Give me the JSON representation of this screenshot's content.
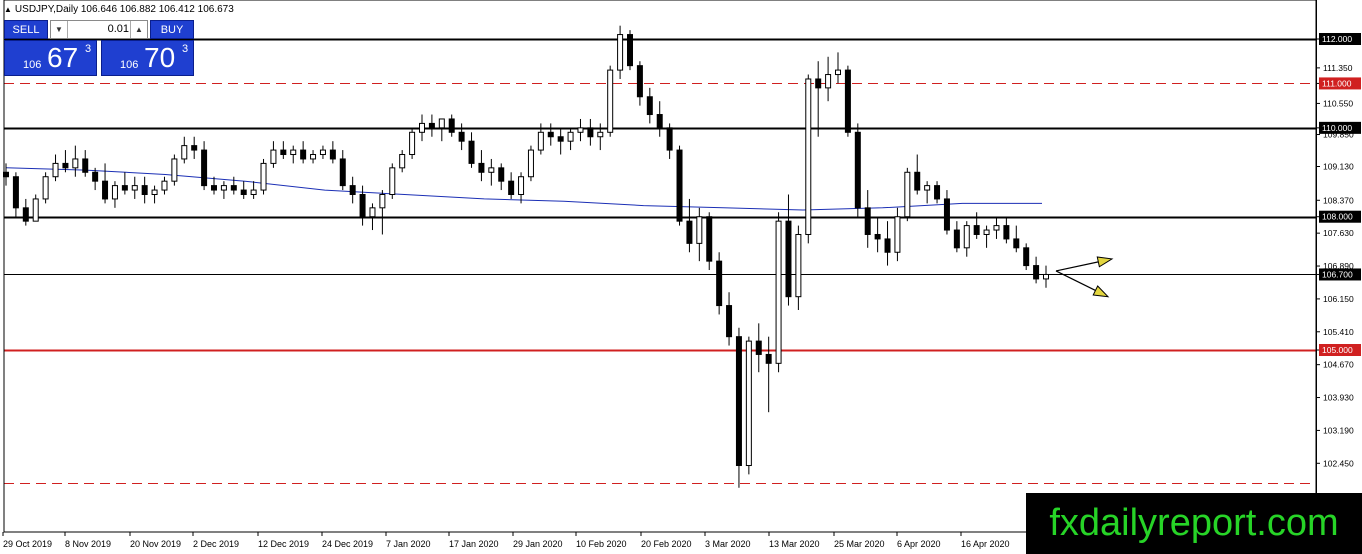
{
  "symbol_line": "USDJPY,Daily  106.646 106.882 106.412 106.673",
  "trade_panel": {
    "sell_label": "SELL",
    "buy_label": "BUY",
    "lot_value": "0.01",
    "sell_price_big": "106",
    "sell_price_large": "67",
    "sell_price_sup": "3",
    "buy_price_big": "106",
    "buy_price_large": "70",
    "buy_price_sup": "3"
  },
  "watermark": "fxdailyreport.com",
  "chart_data": {
    "type": "candlestick",
    "symbol": "USDJPY",
    "timeframe": "Daily",
    "ohlc_current": {
      "open": 106.646,
      "high": 106.882,
      "low": 106.412,
      "close": 106.673
    },
    "ylim": [
      101.8,
      113.0
    ],
    "price_ticks": [
      "112.000",
      "111.350",
      "111.000",
      "110.550",
      "110.000",
      "109.850",
      "109.130",
      "108.370",
      "108.000",
      "107.630",
      "106.890",
      "106.700",
      "106.150",
      "105.410",
      "105.000",
      "104.670",
      "103.930",
      "103.190",
      "102.450"
    ],
    "time_ticks": [
      "29 Oct 2019",
      "8 Nov 2019",
      "20 Nov 2019",
      "2 Dec 2019",
      "12 Dec 2019",
      "24 Dec 2019",
      "7 Jan 2020",
      "17 Jan 2020",
      "29 Jan 2020",
      "10 Feb 2020",
      "20 Feb 2020",
      "3 Mar 2020",
      "13 Mar 2020",
      "25 Mar 2020",
      "6 Apr 2020",
      "16 Apr 2020"
    ],
    "levels": [
      {
        "price": 112.0,
        "label": "112.000",
        "style": "solid",
        "color": "#000000"
      },
      {
        "price": 111.0,
        "label": "111.000",
        "style": "dashed",
        "color": "#d02020"
      },
      {
        "price": 110.0,
        "label": "110.000",
        "style": "solid",
        "color": "#000000"
      },
      {
        "price": 108.0,
        "label": "108.000",
        "style": "solid",
        "color": "#000000"
      },
      {
        "price": 106.7,
        "label": "106.700",
        "style": "solid-thin",
        "color": "#000000"
      },
      {
        "price": 105.0,
        "label": "105.000",
        "style": "solid",
        "color": "#d02020"
      },
      {
        "price": 102.0,
        "label": "",
        "style": "dashed",
        "color": "#d02020"
      }
    ],
    "moving_average": {
      "color": "#1b2fb5",
      "points": [
        [
          0,
          109.1
        ],
        [
          20,
          109.05
        ],
        [
          40,
          108.95
        ],
        [
          60,
          108.8
        ],
        [
          80,
          108.6
        ],
        [
          100,
          108.5
        ],
        [
          120,
          108.4
        ],
        [
          140,
          108.35
        ],
        [
          160,
          108.25
        ],
        [
          180,
          108.2
        ],
        [
          200,
          108.15
        ],
        [
          220,
          108.2
        ],
        [
          240,
          108.3
        ],
        [
          260,
          108.3
        ]
      ]
    },
    "candles": [
      [
        109.0,
        109.2,
        108.7,
        108.9
      ],
      [
        108.9,
        109.0,
        108.0,
        108.2
      ],
      [
        108.2,
        108.4,
        107.8,
        107.9
      ],
      [
        107.9,
        108.5,
        107.9,
        108.4
      ],
      [
        108.4,
        109.0,
        108.3,
        108.9
      ],
      [
        108.9,
        109.4,
        108.8,
        109.2
      ],
      [
        109.2,
        109.5,
        109.0,
        109.1
      ],
      [
        109.1,
        109.6,
        108.9,
        109.3
      ],
      [
        109.3,
        109.5,
        108.9,
        109.0
      ],
      [
        109.0,
        109.1,
        108.6,
        108.8
      ],
      [
        108.8,
        109.2,
        108.3,
        108.4
      ],
      [
        108.4,
        108.8,
        108.2,
        108.7
      ],
      [
        108.7,
        109.0,
        108.5,
        108.6
      ],
      [
        108.6,
        108.9,
        108.4,
        108.7
      ],
      [
        108.7,
        108.9,
        108.3,
        108.5
      ],
      [
        108.5,
        108.7,
        108.3,
        108.6
      ],
      [
        108.6,
        108.9,
        108.5,
        108.8
      ],
      [
        108.8,
        109.4,
        108.7,
        109.3
      ],
      [
        109.3,
        109.8,
        109.2,
        109.6
      ],
      [
        109.6,
        109.8,
        109.3,
        109.5
      ],
      [
        109.5,
        109.7,
        108.6,
        108.7
      ],
      [
        108.7,
        108.9,
        108.5,
        108.6
      ],
      [
        108.6,
        108.8,
        108.4,
        108.7
      ],
      [
        108.7,
        108.9,
        108.5,
        108.6
      ],
      [
        108.6,
        108.8,
        108.4,
        108.5
      ],
      [
        108.5,
        108.8,
        108.4,
        108.6
      ],
      [
        108.6,
        109.3,
        108.5,
        109.2
      ],
      [
        109.2,
        109.7,
        109.1,
        109.5
      ],
      [
        109.5,
        109.7,
        109.3,
        109.4
      ],
      [
        109.4,
        109.6,
        109.2,
        109.5
      ],
      [
        109.5,
        109.7,
        109.2,
        109.3
      ],
      [
        109.3,
        109.5,
        109.2,
        109.4
      ],
      [
        109.4,
        109.6,
        109.3,
        109.5
      ],
      [
        109.5,
        109.7,
        109.2,
        109.3
      ],
      [
        109.3,
        109.5,
        108.6,
        108.7
      ],
      [
        108.7,
        108.9,
        108.3,
        108.5
      ],
      [
        108.5,
        108.7,
        107.8,
        108.0
      ],
      [
        108.0,
        108.3,
        107.7,
        108.2
      ],
      [
        108.2,
        108.6,
        107.6,
        108.5
      ],
      [
        108.5,
        109.2,
        108.4,
        109.1
      ],
      [
        109.1,
        109.5,
        109.0,
        109.4
      ],
      [
        109.4,
        110.0,
        109.3,
        109.9
      ],
      [
        109.9,
        110.3,
        109.7,
        110.1
      ],
      [
        110.1,
        110.3,
        109.8,
        110.0
      ],
      [
        110.0,
        110.2,
        109.7,
        110.2
      ],
      [
        110.2,
        110.3,
        109.8,
        109.9
      ],
      [
        109.9,
        110.1,
        109.5,
        109.7
      ],
      [
        109.7,
        109.9,
        109.1,
        109.2
      ],
      [
        109.2,
        109.5,
        108.8,
        109.0
      ],
      [
        109.0,
        109.3,
        108.7,
        109.1
      ],
      [
        109.1,
        109.2,
        108.6,
        108.8
      ],
      [
        108.8,
        109.0,
        108.4,
        108.5
      ],
      [
        108.5,
        109.0,
        108.3,
        108.9
      ],
      [
        108.9,
        109.6,
        108.8,
        109.5
      ],
      [
        109.5,
        110.1,
        109.4,
        109.9
      ],
      [
        109.9,
        110.1,
        109.6,
        109.8
      ],
      [
        109.8,
        110.0,
        109.4,
        109.7
      ],
      [
        109.7,
        110.0,
        109.5,
        109.9
      ],
      [
        109.9,
        110.2,
        109.7,
        110.0
      ],
      [
        110.0,
        110.2,
        109.6,
        109.8
      ],
      [
        109.8,
        110.1,
        109.5,
        109.9
      ],
      [
        109.9,
        111.4,
        109.8,
        111.3
      ],
      [
        111.3,
        112.3,
        111.1,
        112.1
      ],
      [
        112.1,
        112.2,
        111.3,
        111.4
      ],
      [
        111.4,
        111.5,
        110.5,
        110.7
      ],
      [
        110.7,
        110.9,
        110.1,
        110.3
      ],
      [
        110.3,
        110.6,
        109.8,
        110.0
      ],
      [
        110.0,
        110.1,
        109.3,
        109.5
      ],
      [
        109.5,
        109.6,
        107.8,
        107.9
      ],
      [
        107.9,
        108.4,
        107.2,
        107.4
      ],
      [
        107.4,
        108.2,
        107.0,
        108.0
      ],
      [
        108.0,
        108.1,
        106.8,
        107.0
      ],
      [
        107.0,
        107.2,
        105.8,
        106.0
      ],
      [
        106.0,
        106.3,
        105.1,
        105.3
      ],
      [
        105.3,
        105.5,
        101.9,
        102.4
      ],
      [
        102.4,
        105.3,
        102.2,
        105.2
      ],
      [
        105.2,
        105.6,
        104.5,
        104.9
      ],
      [
        104.9,
        105.3,
        103.6,
        104.7
      ],
      [
        104.7,
        108.1,
        104.5,
        107.9
      ],
      [
        107.9,
        108.5,
        106.0,
        106.2
      ],
      [
        106.2,
        107.8,
        105.9,
        107.6
      ],
      [
        107.6,
        111.2,
        107.4,
        111.1
      ],
      [
        111.1,
        111.5,
        109.8,
        110.9
      ],
      [
        110.9,
        111.6,
        110.6,
        111.2
      ],
      [
        111.2,
        111.7,
        111.0,
        111.3
      ],
      [
        111.3,
        111.4,
        109.8,
        109.9
      ],
      [
        109.9,
        110.1,
        108.0,
        108.2
      ],
      [
        108.2,
        108.6,
        107.3,
        107.6
      ],
      [
        107.6,
        108.0,
        107.2,
        107.5
      ],
      [
        107.5,
        107.9,
        106.9,
        107.2
      ],
      [
        107.2,
        108.2,
        107.0,
        108.0
      ],
      [
        108.0,
        109.1,
        107.9,
        109.0
      ],
      [
        109.0,
        109.4,
        108.5,
        108.6
      ],
      [
        108.6,
        108.8,
        108.3,
        108.7
      ],
      [
        108.7,
        108.8,
        108.3,
        108.4
      ],
      [
        108.4,
        108.6,
        107.6,
        107.7
      ],
      [
        107.7,
        107.9,
        107.2,
        107.3
      ],
      [
        107.3,
        107.9,
        107.1,
        107.8
      ],
      [
        107.8,
        108.1,
        107.5,
        107.6
      ],
      [
        107.6,
        107.8,
        107.3,
        107.7
      ],
      [
        107.7,
        108.0,
        107.5,
        107.8
      ],
      [
        107.8,
        108.0,
        107.4,
        107.5
      ],
      [
        107.5,
        107.8,
        107.2,
        107.3
      ],
      [
        107.3,
        107.4,
        106.8,
        106.9
      ],
      [
        106.9,
        107.1,
        106.5,
        106.6
      ],
      [
        106.6,
        106.9,
        106.4,
        106.7
      ]
    ],
    "arrows": [
      {
        "direction": "up-right"
      },
      {
        "direction": "down-right"
      }
    ]
  }
}
